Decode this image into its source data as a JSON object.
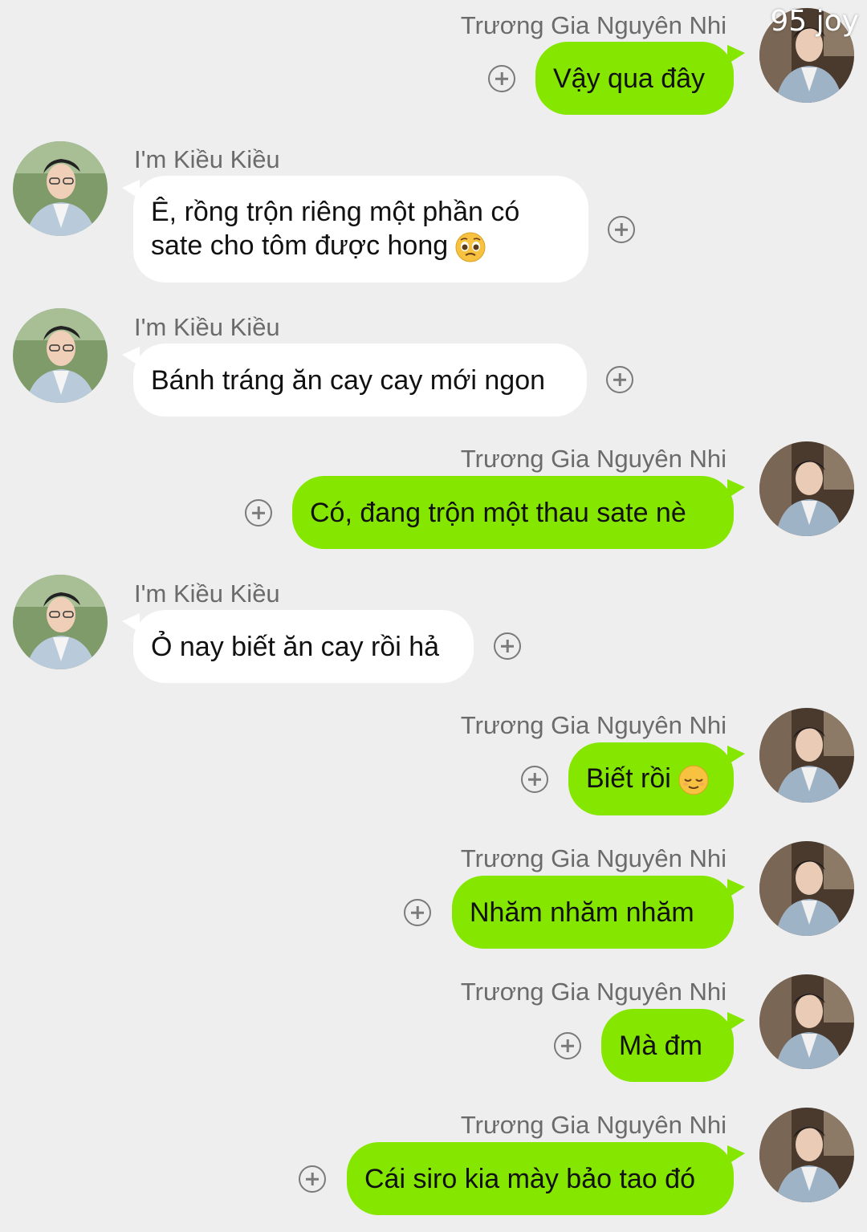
{
  "watermark": "95 joy",
  "contacts": {
    "me": {
      "name": "Trương Gia Nguyên Nhi",
      "avatar_icon": "avatar-me"
    },
    "other": {
      "name": "I'm Kiều Kiều",
      "avatar_icon": "avatar-other"
    }
  },
  "messages": [
    {
      "sender": "Trương Gia Nguyên Nhi",
      "side": "right",
      "text": "Vậy qua đây"
    },
    {
      "sender": "I'm Kiều Kiều",
      "side": "left",
      "text": "Ê, rồng trộn riêng một phần có sate cho tôm được hong",
      "emoji": "pleading-face-icon"
    },
    {
      "sender": "I'm Kiều Kiều",
      "side": "left",
      "text": "Bánh tráng ăn cay cay mới ngon"
    },
    {
      "sender": "Trương Gia Nguyên Nhi",
      "side": "right",
      "text": "Có, đang trộn một thau sate nè"
    },
    {
      "sender": "I'm Kiều Kiều",
      "side": "left",
      "text": "Ỏ nay biết ăn cay rồi hả"
    },
    {
      "sender": "Trương Gia Nguyên Nhi",
      "side": "right",
      "text": "Biết rồi",
      "emoji": "relieved-face-icon"
    },
    {
      "sender": "Trương Gia Nguyên Nhi",
      "side": "right",
      "text": "Nhăm nhăm nhăm"
    },
    {
      "sender": "Trương Gia Nguyên Nhi",
      "side": "right",
      "text": "Mà đm"
    },
    {
      "sender": "Trương Gia Nguyên Nhi",
      "side": "right",
      "text": "Cái siro kia mày bảo tao đó"
    }
  ],
  "colors": {
    "background": "#eeeeee",
    "sent_bubble": "#85e600",
    "received_bubble": "#ffffff",
    "name_text": "#6b6b6b"
  }
}
